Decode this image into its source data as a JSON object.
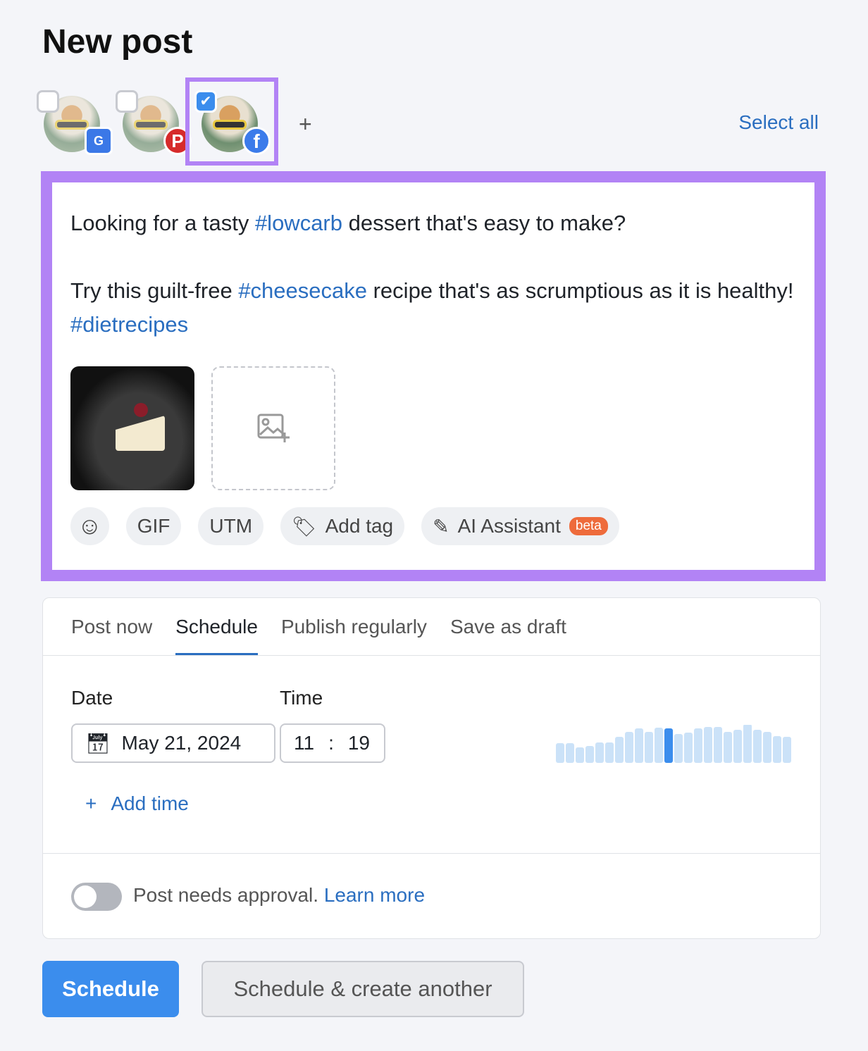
{
  "page": {
    "title": "New post"
  },
  "accounts": [
    {
      "platform": "Google Business Profile",
      "checked": false,
      "badge_color": "#3b78e7"
    },
    {
      "platform": "Pinterest",
      "checked": false,
      "badge_color": "#d62b2b"
    },
    {
      "platform": "Facebook",
      "checked": true,
      "badge_color": "#3b7bea"
    }
  ],
  "accounts_bar": {
    "add": "+",
    "select_all": "Select all"
  },
  "editor": {
    "line1": [
      "Looking for a tasty ",
      "#lowcarb",
      " dessert that's easy to make?"
    ],
    "line2": [
      "Try this guilt-free ",
      "#cheesecake",
      " recipe that's as scrumptious as it is healthy! ",
      "#dietrecipes"
    ],
    "tools": {
      "gif": "GIF",
      "utm": "UTM",
      "add_tag": "Add tag",
      "ai": "AI Assistant",
      "beta": "beta"
    }
  },
  "tabs": [
    {
      "label": "Post now"
    },
    {
      "label": "Schedule",
      "active": true
    },
    {
      "label": "Publish regularly"
    },
    {
      "label": "Save as draft"
    }
  ],
  "schedule": {
    "date_label": "Date",
    "time_label": "Time",
    "date": "May 21, 2024",
    "hour": "11",
    "sep": ":",
    "minute": "19",
    "add_time": "Add time",
    "activity": [
      28,
      28,
      22,
      24,
      29,
      29,
      37,
      44,
      49,
      44,
      50,
      49,
      41,
      43,
      49,
      51,
      51,
      44,
      47,
      55,
      47,
      44,
      38,
      37
    ],
    "highlight_index": 11,
    "colors": {
      "bar": "#cbe2f8",
      "highlight": "#3b8ded"
    }
  },
  "approval": {
    "text": "Post needs approval.",
    "link": "Learn more",
    "enabled": false
  },
  "buttons": {
    "schedule": "Schedule",
    "schedule_another": "Schedule & create another"
  }
}
